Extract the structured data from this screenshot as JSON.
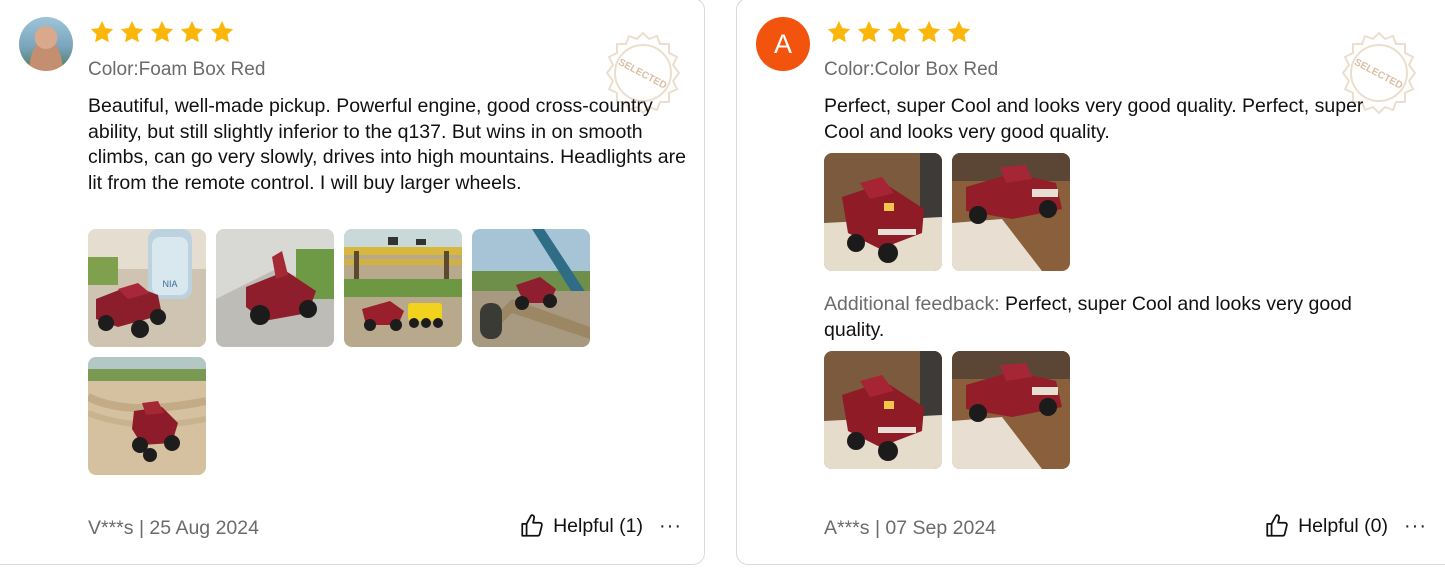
{
  "colors": {
    "star": "#fbb60a",
    "avatar_letter_bg": "#f2540d",
    "muted_text": "#6b6b6b",
    "badge": "#eadbc9"
  },
  "reviews": [
    {
      "avatar": "user-photo",
      "rating": 5,
      "color_label": "Color:Foam Box Red",
      "selected_badge": "SELECTED",
      "text": "Beautiful, well-made pickup. Powerful engine, good cross-country ability, but still slightly inferior to the q137. But wins in on smooth climbs, can go very slowly, drives into high mountains. Headlights are lit from the remote control. I will buy larger wheels.",
      "author_date": "V***s | 25 Aug 2024",
      "helpful_label": "Helpful (1)",
      "more_label": "···"
    },
    {
      "avatar_letter": "A",
      "rating": 5,
      "color_label": "Color:Color Box Red",
      "selected_badge": "SELECTED",
      "text": "Perfect, super Cool and looks very good quality. Perfect, super Cool and looks very good quality.",
      "additional_label": "Additional feedback:",
      "additional_text": "Perfect, super Cool and looks very good quality.",
      "author_date": "A***s | 07 Sep 2024",
      "helpful_label": "Helpful (0)",
      "more_label": "···"
    }
  ]
}
